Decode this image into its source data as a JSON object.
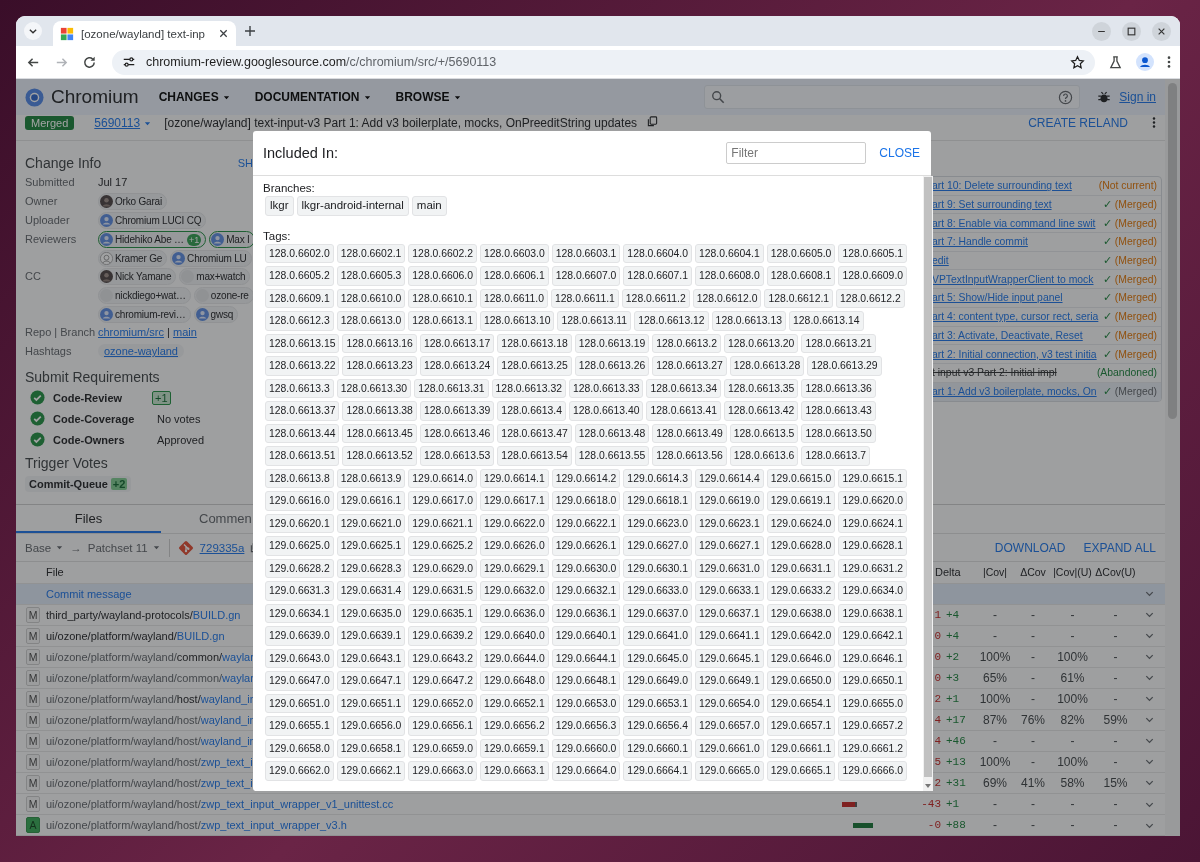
{
  "browser": {
    "tab": {
      "title": "[ozone/wayland] text-inp",
      "selected": true
    },
    "url_host": "chromium-review.googlesource.com",
    "url_path": "/c/chromium/src/+/5690113"
  },
  "header": {
    "brand": "Chromium",
    "menus": [
      "CHANGES",
      "DOCUMENTATION",
      "BROWSE"
    ],
    "sign_in": "Sign in"
  },
  "change": {
    "status": "Merged",
    "number": "5690113",
    "subject": "[ozone/wayland] text-input-v3 Part 1: Add v3 boilerplate, mocks, OnPreeditString updates",
    "action": "CREATE RELAND"
  },
  "change_info": {
    "title": "Change Info",
    "show_all": "SH",
    "fields": [
      {
        "label": "Submitted",
        "kind": "text",
        "value": "Jul 17"
      },
      {
        "label": "Owner",
        "kind": "people",
        "people": [
          {
            "name": "Orko Garai",
            "kind": "photo"
          }
        ]
      },
      {
        "label": "Uploader",
        "kind": "people",
        "people": [
          {
            "name": "Chromium LUCI CQ",
            "kind": "default"
          }
        ]
      },
      {
        "label": "Reviewers",
        "kind": "people",
        "people": [
          {
            "name": "Hidehiko Abe …",
            "kind": "default",
            "voted": true,
            "vote": "+1"
          },
          {
            "name": "Max I",
            "kind": "default",
            "voted": true
          },
          {
            "name": "Kramer Ge",
            "kind": "sketch",
            "voted": false
          },
          {
            "name": "Chromium LU",
            "kind": "default",
            "voted": false
          }
        ]
      },
      {
        "label": "CC",
        "kind": "people",
        "people": [
          {
            "name": "Nick Yamane",
            "kind": "photo"
          },
          {
            "name": "max+watch",
            "kind": "blank"
          },
          {
            "name": "nickdiego+wat…",
            "kind": "blank"
          },
          {
            "name": "ozone-re",
            "kind": "blank"
          },
          {
            "name": "chromium-revi…",
            "kind": "default"
          },
          {
            "name": "gwsq",
            "kind": "default"
          }
        ]
      },
      {
        "label": "Repo | Branch",
        "kind": "repo",
        "repo": "chromium/src",
        "sep": "|",
        "branch": "main"
      },
      {
        "label": "Hashtags",
        "kind": "tags",
        "tags": [
          "ozone-wayland"
        ]
      }
    ]
  },
  "submit_requirements": {
    "title": "Submit Requirements",
    "items": [
      {
        "name": "Code-Review",
        "kind": "vote",
        "value": "+1"
      },
      {
        "name": "Code-Coverage",
        "kind": "text",
        "value": "No votes"
      },
      {
        "name": "Code-Owners",
        "kind": "text",
        "value": "Approved"
      }
    ]
  },
  "trigger_votes": {
    "title": "Trigger Votes",
    "items": [
      {
        "name": "Commit-Queue",
        "vote": "+2"
      }
    ]
  },
  "related": [
    {
      "title": "art 10: Delete surrounding text",
      "kind": "not-current",
      "status": "(Not current)",
      "selected": false
    },
    {
      "title": "art 9: Set surrounding text",
      "kind": "merged",
      "check": "✓",
      "status": "(Merged)",
      "selected": false
    },
    {
      "title": "art 8: Enable via command line swit",
      "kind": "merged",
      "check": "✓",
      "status": "(Merged)",
      "selected": false
    },
    {
      "title": "art 7: Handle commit",
      "kind": "merged",
      "check": "✓",
      "status": "(Merged)",
      "selected": false
    },
    {
      "title": "edit",
      "kind": "merged",
      "check": "✓",
      "status": "(Merged)",
      "selected": false
    },
    {
      "title": "VPTextInputWrapperClient to mock",
      "kind": "merged",
      "check": "✓",
      "status": "(Merged)",
      "selected": false
    },
    {
      "title": "art 5: Show/Hide input panel",
      "kind": "merged",
      "check": "✓",
      "status": "(Merged)",
      "selected": false
    },
    {
      "title": "art 4: content type, cursor rect, seria",
      "kind": "merged",
      "check": "✓",
      "status": "(Merged)",
      "selected": false
    },
    {
      "title": "art 3: Activate, Deactivate, Reset",
      "kind": "merged",
      "check": "✓",
      "status": "(Merged)",
      "selected": false
    },
    {
      "title": "art 2: Initial connection, v3 test initia",
      "kind": "merged",
      "check": "✓",
      "status": "(Merged)",
      "selected": false
    },
    {
      "title": "t input v3 Part 2: Initial impl",
      "kind": "abandoned",
      "status": "(Abandoned)",
      "selected": false
    },
    {
      "title": "art 1: Add v3 boilerplate, mocks, On",
      "kind": "merged",
      "check": "✓",
      "status": "(Merged)",
      "selected": true
    }
  ],
  "files": {
    "tabs": [
      {
        "label": "Files",
        "selected": true
      },
      {
        "label": "Commen",
        "selected": false
      }
    ],
    "base": "Base",
    "arrow": "→",
    "patchset": "Patchset 11",
    "commit": "729335a",
    "actions": [
      "DOWNLOAD",
      "EXPAND ALL"
    ],
    "columns": [
      "File",
      "Delta",
      "|Cov|",
      "ΔCov",
      "|Cov|(U)",
      "ΔCov(U)"
    ],
    "commit_message": "Commit message",
    "rows": [
      {
        "status": "M",
        "kind": "modified",
        "path": [
          {
            "text": "third_party/wayland-protocols/",
            "kind": "new"
          },
          {
            "text": "BUILD.gn",
            "kind": "name"
          }
        ],
        "minus": "1",
        "plus": "+4",
        "cov": "-",
        "dcov": "-",
        "covu": "-",
        "dcovu": "-"
      },
      {
        "status": "M",
        "kind": "modified",
        "path": [
          {
            "text": "ui/ozone/platform/wayland/",
            "kind": "new"
          },
          {
            "text": "BUILD.gn",
            "kind": "name"
          }
        ],
        "minus": "0",
        "plus": "+4",
        "cov": "-",
        "dcov": "-",
        "covu": "-",
        "dcovu": "-"
      },
      {
        "status": "M",
        "kind": "modified",
        "path": [
          {
            "text": "ui/ozone/platform/wayland/",
            "kind": "same"
          },
          {
            "text": "common/",
            "kind": "new"
          },
          {
            "text": "waylar",
            "kind": "name"
          }
        ],
        "minus": "0",
        "plus": "+2",
        "cov": "100%",
        "dcov": "-",
        "covu": "100%",
        "dcovu": "-"
      },
      {
        "status": "M",
        "kind": "modified",
        "path": [
          {
            "text": "ui/ozone/platform/wayland/common/",
            "kind": "same"
          },
          {
            "text": "waylar",
            "kind": "name"
          }
        ],
        "minus": "0",
        "plus": "+3",
        "cov": "65%",
        "dcov": "-",
        "covu": "61%",
        "dcovu": "-"
      },
      {
        "status": "M",
        "kind": "modified",
        "path": [
          {
            "text": "ui/ozone/platform/wayland/",
            "kind": "same"
          },
          {
            "text": "host/",
            "kind": "new"
          },
          {
            "text": "wayland_ir",
            "kind": "name"
          }
        ],
        "minus": "2",
        "plus": "+1",
        "cov": "100%",
        "dcov": "-",
        "covu": "100%",
        "dcovu": "-"
      },
      {
        "status": "M",
        "kind": "modified",
        "path": [
          {
            "text": "ui/ozone/platform/wayland/host/",
            "kind": "same"
          },
          {
            "text": "wayland_ir",
            "kind": "name"
          }
        ],
        "minus": "4",
        "plus": "+17",
        "cov": "87%",
        "dcov": "76%",
        "covu": "82%",
        "dcovu": "59%"
      },
      {
        "status": "M",
        "kind": "modified",
        "path": [
          {
            "text": "ui/ozone/platform/wayland/host/",
            "kind": "same"
          },
          {
            "text": "wayland_ir",
            "kind": "name"
          }
        ],
        "minus": "4",
        "plus": "+46",
        "cov": "-",
        "dcov": "-",
        "covu": "-",
        "dcovu": "-"
      },
      {
        "status": "M",
        "kind": "modified",
        "path": [
          {
            "text": "ui/ozone/platform/wayland/host/",
            "kind": "same"
          },
          {
            "text": "zwp_text_i",
            "kind": "name"
          }
        ],
        "minus": "5",
        "plus": "+13",
        "cov": "100%",
        "dcov": "-",
        "covu": "100%",
        "dcovu": "-"
      },
      {
        "status": "M",
        "kind": "modified",
        "path": [
          {
            "text": "ui/ozone/platform/wayland/host/",
            "kind": "same"
          },
          {
            "text": "zwp_text_i",
            "kind": "name"
          }
        ],
        "minus": "2",
        "plus": "+31",
        "cov": "69%",
        "dcov": "41%",
        "covu": "58%",
        "dcovu": "15%"
      },
      {
        "status": "M",
        "kind": "modified",
        "path": [
          {
            "text": "ui/ozone/platform/wayland/host/",
            "kind": "same"
          },
          {
            "text": "zwp_text_input_wrapper_v1_unittest.cc",
            "kind": "name"
          }
        ],
        "bar": {
          "kind": "deleted"
        },
        "minus": "-43",
        "plus": "+1",
        "cov": "-",
        "dcov": "-",
        "covu": "-",
        "dcovu": "-"
      },
      {
        "status": "A",
        "kind": "added",
        "path": [
          {
            "text": "ui/ozone/platform/wayland/host/",
            "kind": "same"
          },
          {
            "text": "zwp_text_input_wrapper_v3.h",
            "kind": "name"
          }
        ],
        "bar": {
          "kind": "added"
        },
        "minus": "-0",
        "plus": "+88",
        "cov": "-",
        "dcov": "-",
        "covu": "-",
        "dcovu": "-"
      }
    ]
  },
  "dialog": {
    "title": "Included In:",
    "filter_placeholder": "Filter",
    "close": "CLOSE",
    "branches_label": "Branches:",
    "branches": [
      "lkgr",
      "lkgr-android-internal",
      "main"
    ],
    "tags_label": "Tags:",
    "tags": [
      "128.0.6602.0",
      "128.0.6602.1",
      "128.0.6602.2",
      "128.0.6603.0",
      "128.0.6603.1",
      "128.0.6604.0",
      "128.0.6604.1",
      "128.0.6605.0",
      "128.0.6605.1",
      "128.0.6605.2",
      "128.0.6605.3",
      "128.0.6606.0",
      "128.0.6606.1",
      "128.0.6607.0",
      "128.0.6607.1",
      "128.0.6608.0",
      "128.0.6608.1",
      "128.0.6609.0",
      "128.0.6609.1",
      "128.0.6610.0",
      "128.0.6610.1",
      "128.0.6611.0",
      "128.0.6611.1",
      "128.0.6611.2",
      "128.0.6612.0",
      "128.0.6612.1",
      "128.0.6612.2",
      "128.0.6612.3",
      "128.0.6613.0",
      "128.0.6613.1",
      "128.0.6613.10",
      "128.0.6613.11",
      "128.0.6613.12",
      "128.0.6613.13",
      "128.0.6613.14",
      "128.0.6613.15",
      "128.0.6613.16",
      "128.0.6613.17",
      "128.0.6613.18",
      "128.0.6613.19",
      "128.0.6613.2",
      "128.0.6613.20",
      "128.0.6613.21",
      "128.0.6613.22",
      "128.0.6613.23",
      "128.0.6613.24",
      "128.0.6613.25",
      "128.0.6613.26",
      "128.0.6613.27",
      "128.0.6613.28",
      "128.0.6613.29",
      "128.0.6613.3",
      "128.0.6613.30",
      "128.0.6613.31",
      "128.0.6613.32",
      "128.0.6613.33",
      "128.0.6613.34",
      "128.0.6613.35",
      "128.0.6613.36",
      "128.0.6613.37",
      "128.0.6613.38",
      "128.0.6613.39",
      "128.0.6613.4",
      "128.0.6613.40",
      "128.0.6613.41",
      "128.0.6613.42",
      "128.0.6613.43",
      "128.0.6613.44",
      "128.0.6613.45",
      "128.0.6613.46",
      "128.0.6613.47",
      "128.0.6613.48",
      "128.0.6613.49",
      "128.0.6613.5",
      "128.0.6613.50",
      "128.0.6613.51",
      "128.0.6613.52",
      "128.0.6613.53",
      "128.0.6613.54",
      "128.0.6613.55",
      "128.0.6613.56",
      "128.0.6613.6",
      "128.0.6613.7",
      "128.0.6613.8",
      "128.0.6613.9",
      "129.0.6614.0",
      "129.0.6614.1",
      "129.0.6614.2",
      "129.0.6614.3",
      "129.0.6614.4",
      "129.0.6615.0",
      "129.0.6615.1",
      "129.0.6616.0",
      "129.0.6616.1",
      "129.0.6617.0",
      "129.0.6617.1",
      "129.0.6618.0",
      "129.0.6618.1",
      "129.0.6619.0",
      "129.0.6619.1",
      "129.0.6620.0",
      "129.0.6620.1",
      "129.0.6621.0",
      "129.0.6621.1",
      "129.0.6622.0",
      "129.0.6622.1",
      "129.0.6623.0",
      "129.0.6623.1",
      "129.0.6624.0",
      "129.0.6624.1",
      "129.0.6625.0",
      "129.0.6625.1",
      "129.0.6625.2",
      "129.0.6626.0",
      "129.0.6626.1",
      "129.0.6627.0",
      "129.0.6627.1",
      "129.0.6628.0",
      "129.0.6628.1",
      "129.0.6628.2",
      "129.0.6628.3",
      "129.0.6629.0",
      "129.0.6629.1",
      "129.0.6630.0",
      "129.0.6630.1",
      "129.0.6631.0",
      "129.0.6631.1",
      "129.0.6631.2",
      "129.0.6631.3",
      "129.0.6631.4",
      "129.0.6631.5",
      "129.0.6632.0",
      "129.0.6632.1",
      "129.0.6633.0",
      "129.0.6633.1",
      "129.0.6633.2",
      "129.0.6634.0",
      "129.0.6634.1",
      "129.0.6635.0",
      "129.0.6635.1",
      "129.0.6636.0",
      "129.0.6636.1",
      "129.0.6637.0",
      "129.0.6637.1",
      "129.0.6638.0",
      "129.0.6638.1",
      "129.0.6639.0",
      "129.0.6639.1",
      "129.0.6639.2",
      "129.0.6640.0",
      "129.0.6640.1",
      "129.0.6641.0",
      "129.0.6641.1",
      "129.0.6642.0",
      "129.0.6642.1",
      "129.0.6643.0",
      "129.0.6643.1",
      "129.0.6643.2",
      "129.0.6644.0",
      "129.0.6644.1",
      "129.0.6645.0",
      "129.0.6645.1",
      "129.0.6646.0",
      "129.0.6646.1",
      "129.0.6647.0",
      "129.0.6647.1",
      "129.0.6647.2",
      "129.0.6648.0",
      "129.0.6648.1",
      "129.0.6649.0",
      "129.0.6649.1",
      "129.0.6650.0",
      "129.0.6650.1",
      "129.0.6651.0",
      "129.0.6651.1",
      "129.0.6652.0",
      "129.0.6652.1",
      "129.0.6653.0",
      "129.0.6653.1",
      "129.0.6654.0",
      "129.0.6654.1",
      "129.0.6655.0",
      "129.0.6655.1",
      "129.0.6656.0",
      "129.0.6656.1",
      "129.0.6656.2",
      "129.0.6656.3",
      "129.0.6656.4",
      "129.0.6657.0",
      "129.0.6657.1",
      "129.0.6657.2",
      "129.0.6658.0",
      "129.0.6658.1",
      "129.0.6659.0",
      "129.0.6659.1",
      "129.0.6660.0",
      "129.0.6660.1",
      "129.0.6661.0",
      "129.0.6661.1",
      "129.0.6661.2",
      "129.0.6662.0",
      "129.0.6662.1",
      "129.0.6663.0",
      "129.0.6663.1",
      "129.0.6664.0",
      "129.0.6664.1",
      "129.0.6665.0",
      "129.0.6665.1",
      "129.0.6666.0"
    ]
  }
}
